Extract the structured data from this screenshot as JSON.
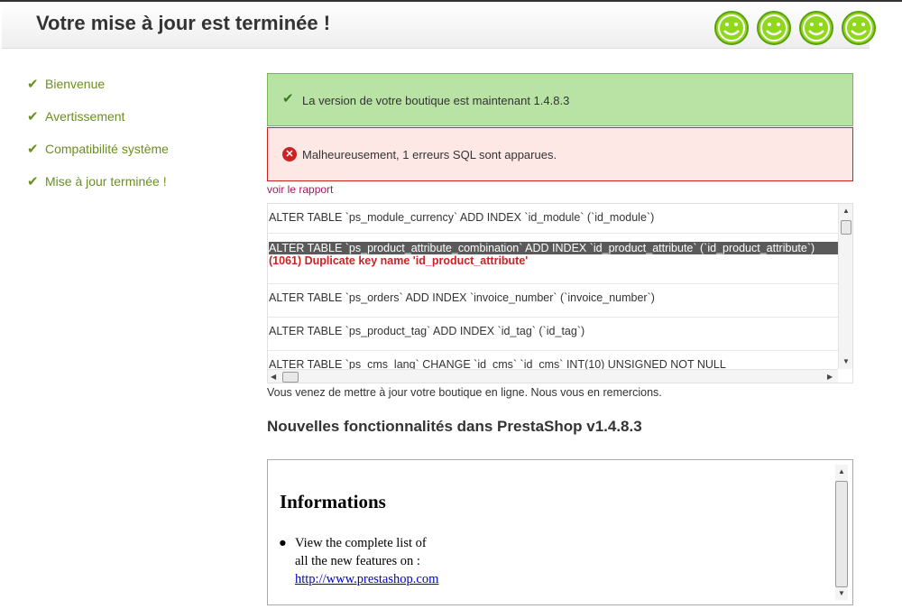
{
  "header": {
    "title": "Votre mise à jour est terminée !"
  },
  "sidebar": {
    "items": [
      {
        "label": "Bienvenue"
      },
      {
        "label": "Avertissement"
      },
      {
        "label": "Compatibilité système"
      },
      {
        "label": "Mise à jour terminée !"
      }
    ]
  },
  "alerts": {
    "success": "La version de votre boutique est maintenant 1.4.8.3",
    "error": "Malheureusement, 1 erreurs SQL sont apparues."
  },
  "report_link": "voir le rapport",
  "sql_log": {
    "rows": [
      {
        "query": "ALTER TABLE `ps_module_currency` ADD INDEX `id_module` (`id_module`)",
        "error": ""
      },
      {
        "query": "ALTER TABLE `ps_product_attribute_combination` ADD INDEX `id_product_attribute` (`id_product_attribute`)",
        "error": "(1061) Duplicate key name 'id_product_attribute'"
      },
      {
        "query": "ALTER TABLE `ps_orders` ADD INDEX `invoice_number` (`invoice_number`)",
        "error": ""
      },
      {
        "query": "ALTER TABLE `ps_product_tag` ADD INDEX `id_tag` (`id_tag`)",
        "error": ""
      },
      {
        "query": "ALTER TABLE `ps_cms_lang` CHANGE `id_cms` `id_cms` INT(10) UNSIGNED NOT NULL",
        "error": ""
      }
    ]
  },
  "thanks_text": "Vous venez de mettre à jour votre boutique en ligne. Nous vous en remercions.",
  "features": {
    "title": "Nouvelles fonctionnalités dans PrestaShop v1.4.8.3",
    "info_title": "Informations",
    "info_line1": "View the complete list of",
    "info_line2": "all the new features on :",
    "info_link": "http://www.prestashop.com"
  },
  "colors": {
    "accent_green": "#6a8f1e",
    "success_bg": "#b8e3a5",
    "error_border": "#cc2222",
    "error_bg": "#fde8e5"
  },
  "icons": {
    "smiley": "smiley-icon",
    "check": "check-icon",
    "error": "error-icon"
  }
}
